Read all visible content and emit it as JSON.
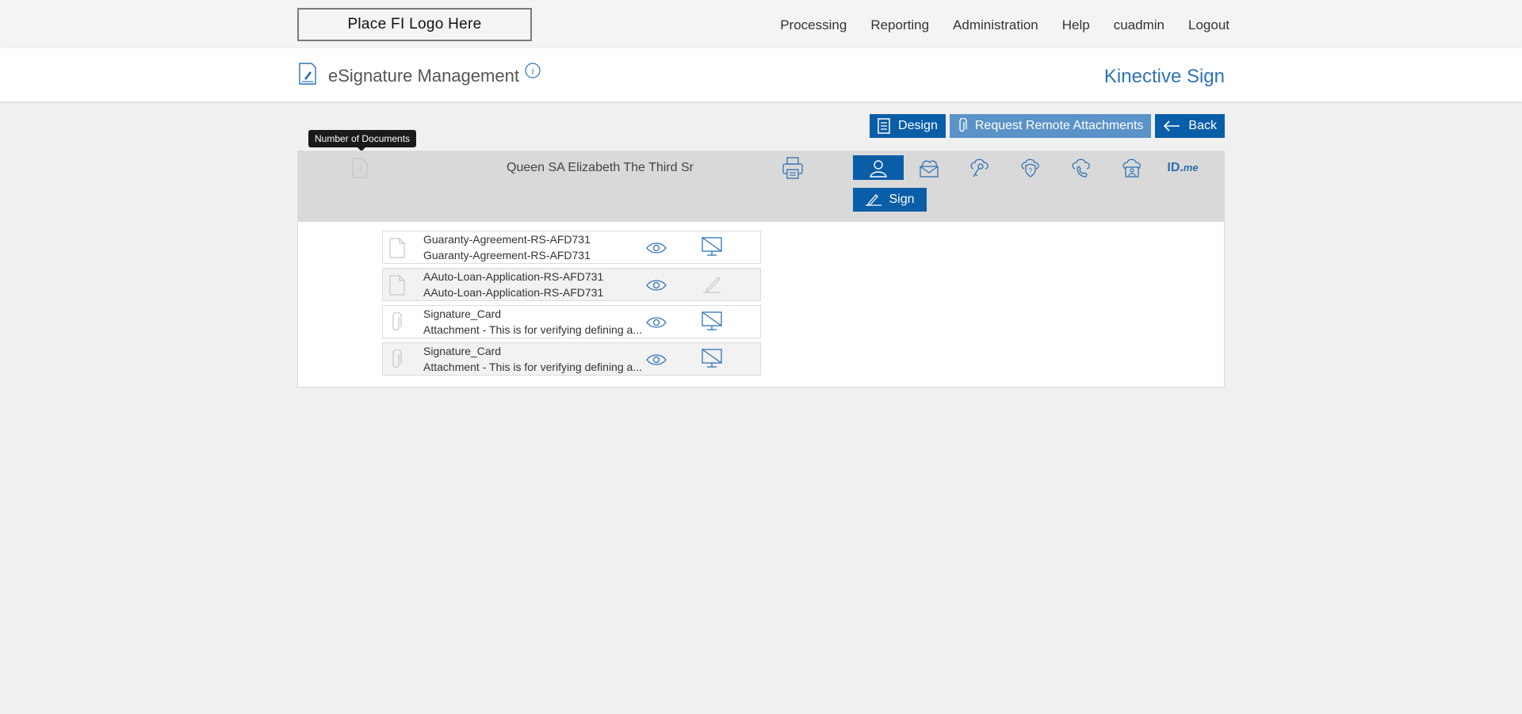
{
  "topbar": {
    "logo_text": "Place FI Logo Here",
    "nav": [
      "Processing",
      "Reporting",
      "Administration",
      "Help",
      "cuadmin",
      "Logout"
    ]
  },
  "header": {
    "title": "eSignature Management",
    "brand": "Kinective Sign"
  },
  "toolbar": {
    "design": "Design",
    "request_attachments": "Request Remote Attachments",
    "back": "Back"
  },
  "tooltip": "Number of Documents",
  "signer": {
    "name": "Queen SA Elizabeth The Third Sr",
    "sign_label": "Sign",
    "idme_prefix": "ID.",
    "idme_suffix": "me"
  },
  "documents": [
    {
      "line1": "Guaranty-Agreement-RS-AFD731",
      "line2": "Guaranty-Agreement-RS-AFD731",
      "type": "document-icon",
      "action": "monitor-disabled-icon"
    },
    {
      "line1": "AAuto-Loan-Application-RS-AFD731",
      "line2": "AAuto-Loan-Application-RS-AFD731",
      "type": "document-icon",
      "action": "pen-icon"
    },
    {
      "line1": "Signature_Card",
      "line2": "Attachment - This is for verifying defining a...",
      "type": "paperclip-icon",
      "action": "monitor-disabled-icon"
    },
    {
      "line1": "Signature_Card",
      "line2": "Attachment - This is for verifying defining a...",
      "type": "paperclip-icon",
      "action": "monitor-disabled-icon"
    }
  ],
  "colors": {
    "primary": "#0a5ea8",
    "primary_light": "#5b93c8",
    "brand": "#2f73b5",
    "signer_bar": "#d9d9d9"
  }
}
